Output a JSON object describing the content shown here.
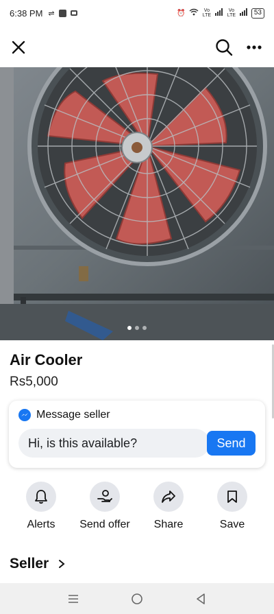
{
  "status_bar": {
    "time": "6:38 PM",
    "battery": "53",
    "icons": [
      "alarm-icon",
      "wifi-icon",
      "signal-icon",
      "signal-icon",
      "battery-icon"
    ],
    "network_label_1": "Vo LTE",
    "network_label_2": "Vo LTE"
  },
  "header": {
    "close_icon": "close-icon",
    "search_icon": "search-icon",
    "more_icon": "more-options-icon"
  },
  "photo": {
    "alt": "Air cooler with red fan blades",
    "page_count": 3,
    "active_page": 1
  },
  "listing": {
    "title": "Air Cooler",
    "price": "Rs5,000"
  },
  "message": {
    "header": "Message seller",
    "input_value": "Hi, is this available?",
    "send_label": "Send"
  },
  "actions": [
    {
      "label": "Alerts",
      "icon": "bell-icon"
    },
    {
      "label": "Send offer",
      "icon": "send-offer-icon"
    },
    {
      "label": "Share",
      "icon": "share-icon"
    },
    {
      "label": "Save",
      "icon": "bookmark-icon"
    }
  ],
  "seller": {
    "label": "Seller"
  },
  "colors": {
    "accent": "#1877f2",
    "action_bg": "#e4e6eb",
    "input_bg": "#eff1f4"
  }
}
